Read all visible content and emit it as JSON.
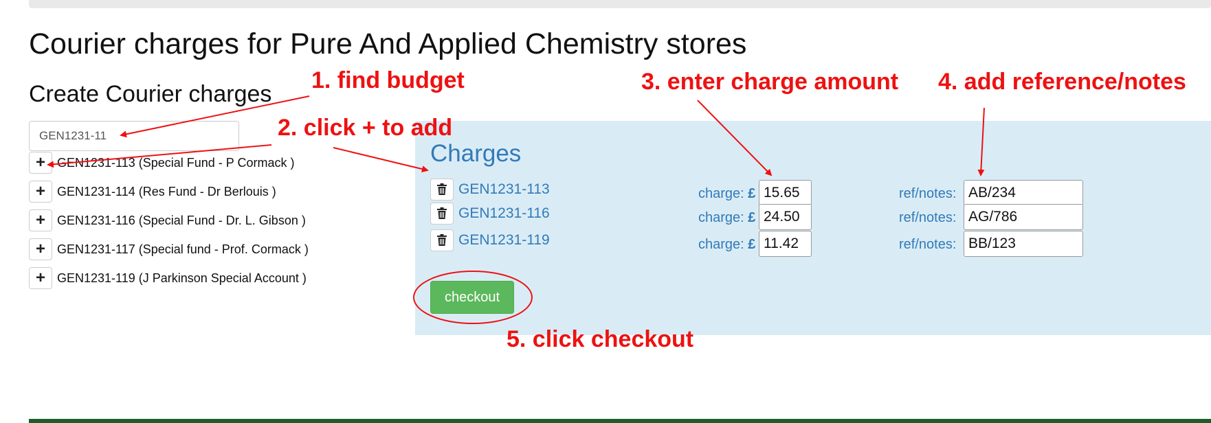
{
  "page": {
    "title": "Courier charges for Pure And Applied Chemistry stores",
    "section_title": "Create Courier charges"
  },
  "search": {
    "value": "GEN1231-11"
  },
  "budgets": [
    {
      "label": "GEN1231-113 (Special Fund - P Cormack )"
    },
    {
      "label": "GEN1231-114 (Res Fund - Dr Berlouis )"
    },
    {
      "label": "GEN1231-116 (Special Fund - Dr. L. Gibson )"
    },
    {
      "label": "GEN1231-117 (Special fund - Prof. Cormack )"
    },
    {
      "label": "GEN1231-119 (J Parkinson Special Account )"
    }
  ],
  "charges": {
    "title": "Charges",
    "charge_label": "charge: ",
    "currency": "£",
    "ref_label": "ref/notes:",
    "rows": [
      {
        "code": "GEN1231-113",
        "amount": "15.65",
        "ref": "AB/234"
      },
      {
        "code": "GEN1231-116",
        "amount": "24.50",
        "ref": "AG/786"
      },
      {
        "code": "GEN1231-119",
        "amount": "11.42",
        "ref": "BB/123"
      }
    ],
    "checkout_label": "checkout"
  },
  "annotations": {
    "step1": "1. find budget",
    "step2": "2. click + to add",
    "step3": "3. enter charge amount",
    "step4": "4. add reference/notes",
    "step5": "5. click checkout"
  },
  "colors": {
    "panel": "#d9ecf6",
    "link": "#337ab7",
    "checkout": "#5cb85c",
    "annotation": "#ee1111",
    "footer": "#1e5c2a"
  }
}
